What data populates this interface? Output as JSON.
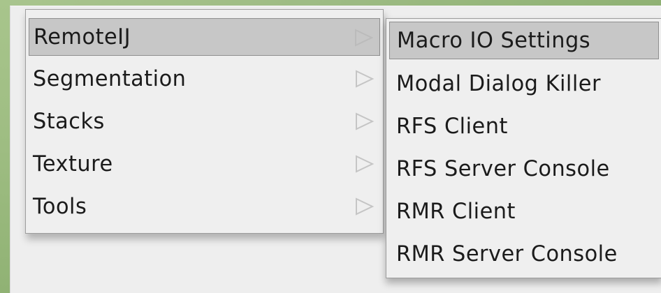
{
  "primary_menu": {
    "items": [
      {
        "label": "RemoteIJ",
        "selected": true,
        "icon": "chevron-right-icon"
      },
      {
        "label": "Segmentation",
        "selected": false,
        "icon": "chevron-right-icon"
      },
      {
        "label": "Stacks",
        "selected": false,
        "icon": "chevron-right-icon"
      },
      {
        "label": "Texture",
        "selected": false,
        "icon": "chevron-right-icon"
      },
      {
        "label": "Tools",
        "selected": false,
        "icon": "chevron-right-icon"
      }
    ]
  },
  "submenu": {
    "items": [
      {
        "label": "Macro IO Settings",
        "selected": true
      },
      {
        "label": "Modal Dialog Killer",
        "selected": false
      },
      {
        "label": "RFS Client",
        "selected": false
      },
      {
        "label": "RFS Server Console",
        "selected": false
      },
      {
        "label": "RMR Client",
        "selected": false
      },
      {
        "label": "RMR Server Console",
        "selected": false
      }
    ]
  },
  "colors": {
    "background": "#9dbb83",
    "menu_background": "#efefef",
    "selection": "#c7c7c7",
    "text": "#1b1b1b"
  }
}
